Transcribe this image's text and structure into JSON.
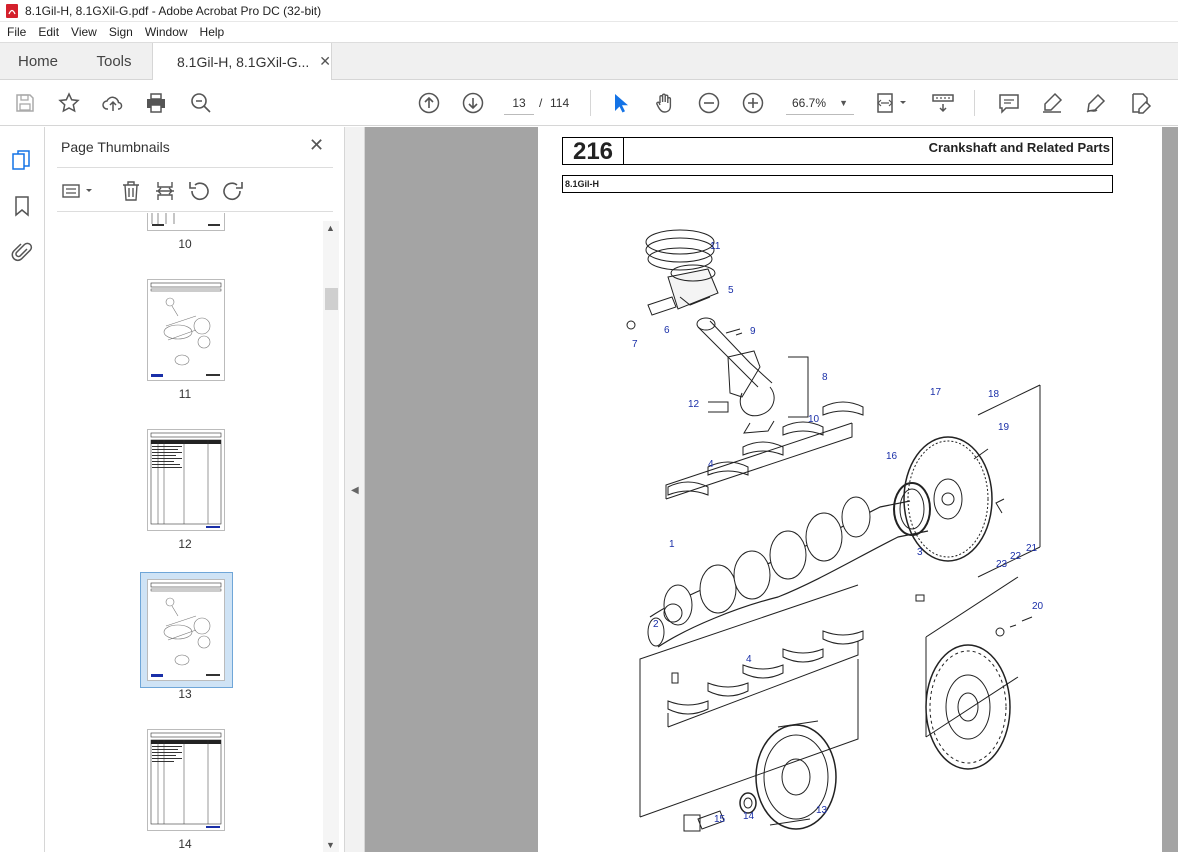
{
  "window": {
    "title": "8.1Gil-H, 8.1GXil-G.pdf - Adobe Acrobat Pro DC (32-bit)"
  },
  "menu": [
    "File",
    "Edit",
    "View",
    "Sign",
    "Window",
    "Help"
  ],
  "tabs": {
    "home": "Home",
    "tools": "Tools",
    "doc": "8.1Gil-H, 8.1GXil-G..."
  },
  "nav": {
    "current_page": "13",
    "separator": "/",
    "total_pages": "114",
    "zoom": "66.7%"
  },
  "panel": {
    "title": "Page Thumbnails",
    "thumbnails": [
      {
        "label": "10"
      },
      {
        "label": "11"
      },
      {
        "label": "12"
      },
      {
        "label": "13",
        "selected": true
      },
      {
        "label": "14"
      }
    ]
  },
  "document": {
    "page_number": "216",
    "section_title": "Crankshaft and Related Parts",
    "model": "8.1Gil-H",
    "callouts": [
      "11",
      "5",
      "6",
      "7",
      "9",
      "8",
      "12",
      "10",
      "17",
      "18",
      "19",
      "16",
      "4",
      "1",
      "3",
      "23",
      "22",
      "21",
      "20",
      "2",
      "4",
      "15",
      "14",
      "13"
    ]
  },
  "colors": {
    "accent": "#1473e6",
    "callout": "#1a2fa8",
    "doc_bg": "#a4a4a4"
  }
}
